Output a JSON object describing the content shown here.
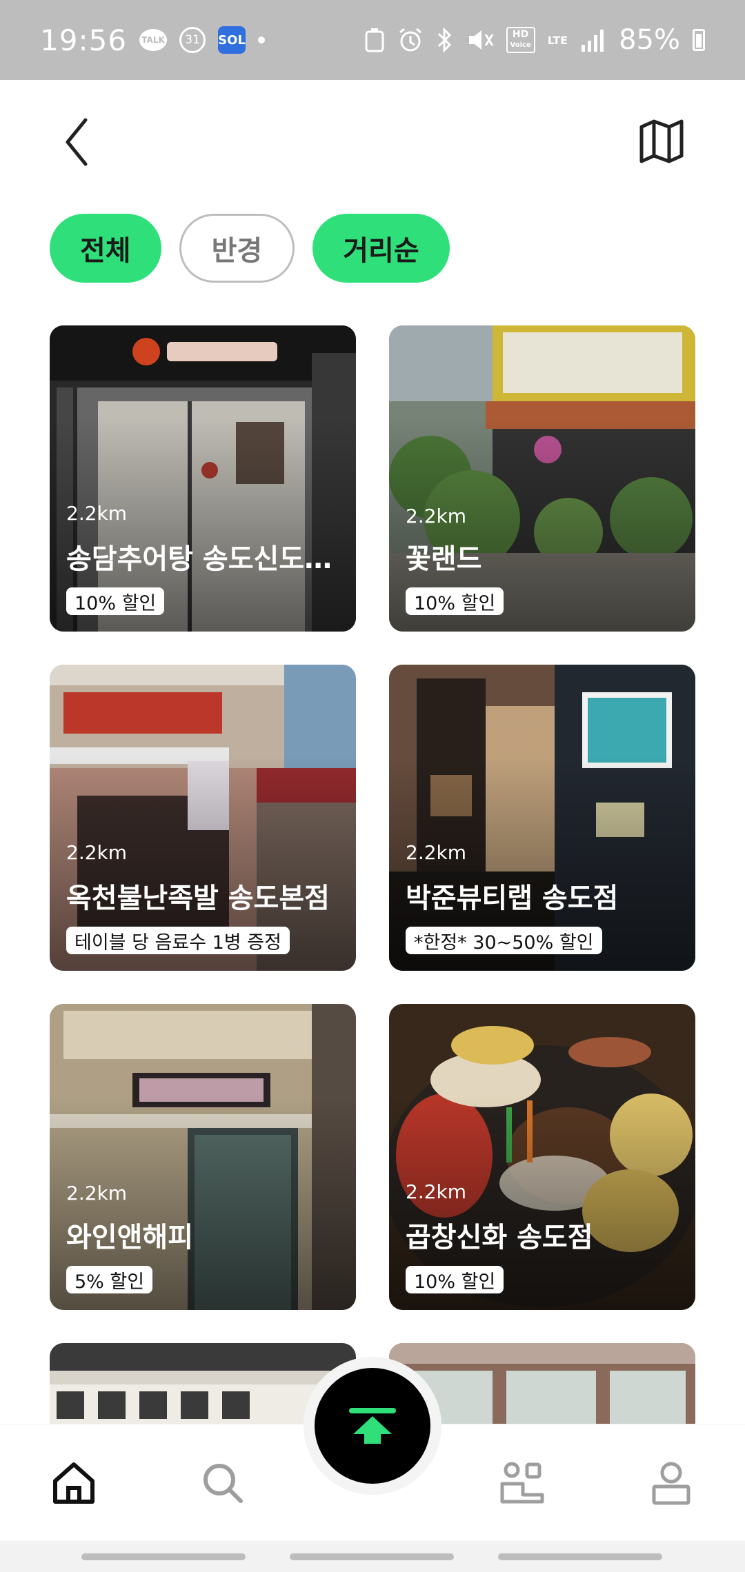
{
  "status_bar": {
    "time": "19:56",
    "notif_talk": "TALK",
    "notif_calendar": "31",
    "notif_sol": "SOL",
    "hd_voice": "HD",
    "hd_voice_sub": "Voice",
    "network": "LTE",
    "battery": "85%"
  },
  "header": {
    "back_icon": "chevron-left-icon",
    "map_icon": "map-icon"
  },
  "filters": [
    {
      "label": "전체",
      "active": true
    },
    {
      "label": "반경",
      "active": false
    },
    {
      "label": "거리순",
      "active": true
    }
  ],
  "stores": [
    {
      "distance": "2.2km",
      "name": "송담추어탕 송도신도시점",
      "benefit": "10% 할인"
    },
    {
      "distance": "2.2km",
      "name": "꽃랜드",
      "benefit": "10% 할인"
    },
    {
      "distance": "2.2km",
      "name": "옥천불난족발 송도본점",
      "benefit": "테이블 당 음료수 1병 증정"
    },
    {
      "distance": "2.2km",
      "name": "박준뷰티랩 송도점",
      "benefit": "*한정* 30~50% 할인"
    },
    {
      "distance": "2.2km",
      "name": "와인앤해피",
      "benefit": "5% 할인"
    },
    {
      "distance": "2.2km",
      "name": "곱창신화 송도점",
      "benefit": "10% 할인"
    }
  ],
  "bottom_nav": {
    "home_icon": "home-icon",
    "search_icon": "search-icon",
    "fab_icon": "green-arrow-up-icon",
    "store_icon": "store-icon",
    "profile_icon": "profile-icon"
  },
  "colors": {
    "accent": "#2fe07a",
    "status_bar": "#bdbdbd",
    "fab": "#000000"
  }
}
